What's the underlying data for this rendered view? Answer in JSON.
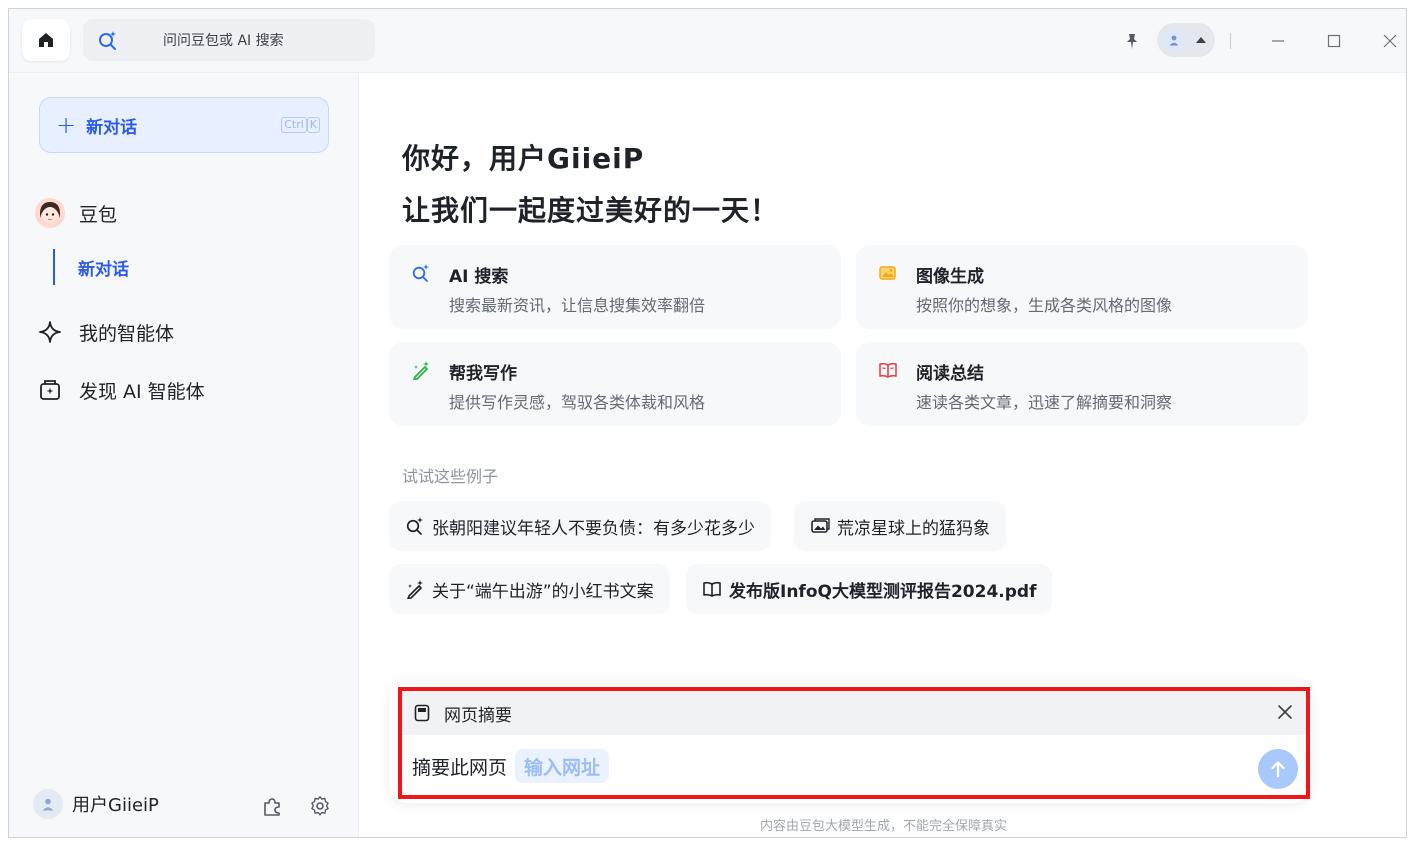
{
  "titlebar": {
    "search_placeholder": "问问豆包或 AI 搜索",
    "icons": [
      "home-icon",
      "ai-search-icon",
      "pin-icon",
      "user-icon",
      "caret-up-icon",
      "minimize-icon",
      "maximize-icon",
      "close-icon"
    ]
  },
  "sidebar": {
    "new_chat_label": "新对话",
    "shortcut_keys": [
      "Ctrl",
      "K"
    ],
    "items": [
      {
        "label": "豆包",
        "icon": "doubao-avatar"
      },
      {
        "label": "我的智能体",
        "icon": "sparkle-icon"
      },
      {
        "label": "发现 AI 智能体",
        "icon": "discover-agent-icon"
      }
    ],
    "sub_item_label": "新对话",
    "user_name": "用户GiieiP",
    "footer_icons": [
      "plugin-icon",
      "settings-icon"
    ]
  },
  "main": {
    "greeting_line1": "你好，用户GiieiP",
    "greeting_line2": "让我们一起度过美好的一天！",
    "cards": [
      {
        "title": "AI 搜索",
        "desc": "搜索最新资讯，让信息搜集效率翻倍",
        "icon": "ai-search-icon",
        "color": "#2b6bf0"
      },
      {
        "title": "图像生成",
        "desc": "按照你的想象，生成各类风格的图像",
        "icon": "image-gen-icon",
        "color": "#f2a818"
      },
      {
        "title": "帮我写作",
        "desc": "提供写作灵感，驾驭各类体裁和风格",
        "icon": "writing-icon",
        "color": "#2bb24c"
      },
      {
        "title": "阅读总结",
        "desc": "速读各类文章，迅速了解摘要和洞察",
        "icon": "reading-icon",
        "color": "#e8424b"
      }
    ],
    "examples_label": "试试这些例子",
    "examples": [
      {
        "text": "张朝阳建议年轻人不要负债：有多少花多少",
        "icon": "ai-search-icon"
      },
      {
        "text": "荒凉星球上的猛犸象",
        "icon": "image-gen-icon"
      },
      {
        "text": "关于“端午出游”的小红书文案",
        "icon": "writing-icon"
      },
      {
        "text": "发布版InfoQ大模型测评报告2024.pdf",
        "icon": "reading-icon"
      }
    ]
  },
  "input": {
    "skill_label": "网页摘要",
    "prefix": "摘要此网页",
    "slot_placeholder": "输入网址",
    "send_icon": "send-arrow-icon",
    "close_icon": "close-icon"
  },
  "disclaimer": "内容由豆包大模型生成，不能完全保障真实",
  "colors": {
    "accent": "#2b5ce6",
    "highlight_border": "#f0161c",
    "send_disabled": "#a9c8fb"
  }
}
